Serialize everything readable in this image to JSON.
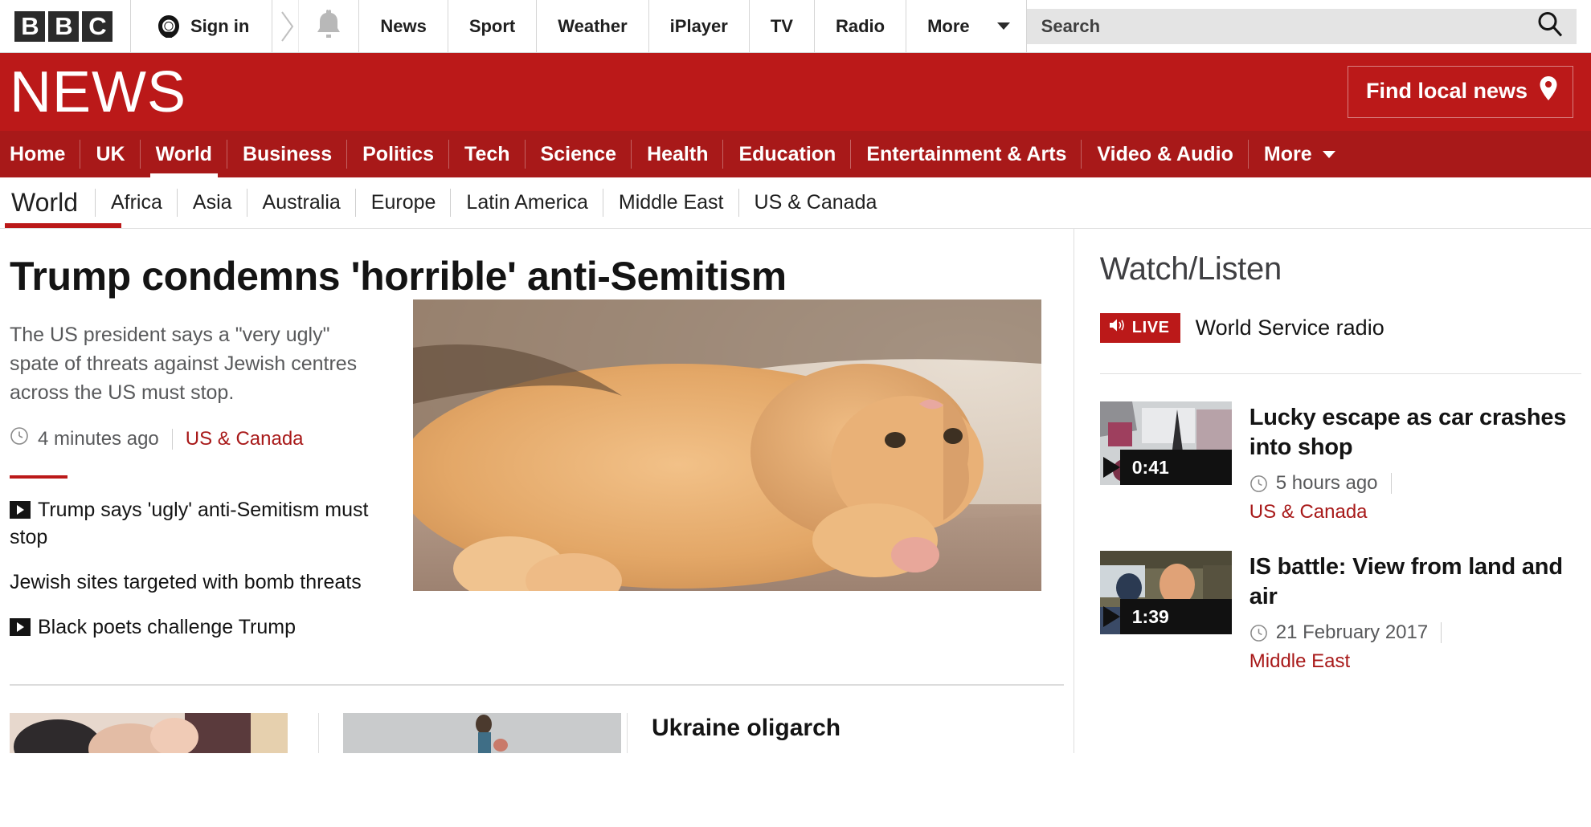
{
  "brand": {
    "logo_letters": [
      "B",
      "B",
      "C"
    ],
    "masthead_title": "NEWS",
    "accent_red": "#bb1919",
    "nav_red": "#a81919",
    "link_red": "#a81919"
  },
  "global_bar": {
    "sign_in": "Sign in",
    "account_icon": "account-icon",
    "chevron_icon": "chevron-right-icon",
    "notifications_icon": "bell-icon",
    "links": [
      "News",
      "Sport",
      "Weather",
      "iPlayer",
      "TV",
      "Radio"
    ],
    "more_label": "More",
    "search": {
      "placeholder": "Search",
      "value": "",
      "icon": "search-icon"
    }
  },
  "masthead": {
    "find_local_news": "Find local news",
    "location_icon": "location-pin-icon"
  },
  "primary_nav": {
    "items": [
      {
        "label": "Home",
        "active": false
      },
      {
        "label": "UK",
        "active": false
      },
      {
        "label": "World",
        "active": true
      },
      {
        "label": "Business",
        "active": false
      },
      {
        "label": "Politics",
        "active": false
      },
      {
        "label": "Tech",
        "active": false
      },
      {
        "label": "Science",
        "active": false
      },
      {
        "label": "Health",
        "active": false
      },
      {
        "label": "Education",
        "active": false
      },
      {
        "label": "Entertainment & Arts",
        "active": false
      },
      {
        "label": "Video & Audio",
        "active": false
      }
    ],
    "more_label": "More"
  },
  "sub_nav": {
    "items": [
      {
        "label": "World",
        "active": true
      },
      {
        "label": "Africa",
        "active": false
      },
      {
        "label": "Asia",
        "active": false
      },
      {
        "label": "Australia",
        "active": false
      },
      {
        "label": "Europe",
        "active": false
      },
      {
        "label": "Latin America",
        "active": false
      },
      {
        "label": "Middle East",
        "active": false
      },
      {
        "label": "US & Canada",
        "active": false
      }
    ]
  },
  "top_story": {
    "headline": "Trump condemns 'horrible' anti-Semitism",
    "summary": "The US president says a \"very ugly\" spate of threats against Jewish centres across the US must stop.",
    "timestamp": "4 minutes ago",
    "topic": "US & Canada",
    "clock_icon": "clock-icon",
    "image_alt": "ginger cat lying on carpet",
    "related": [
      {
        "label": "Trump says 'ugly' anti-Semitism must stop",
        "video": true
      },
      {
        "label": "Jewish sites targeted with bomb threats",
        "video": false
      },
      {
        "label": "Black poets challenge Trump",
        "video": true
      }
    ]
  },
  "story_row": {
    "items": [
      {
        "title": "",
        "has_image": true
      },
      {
        "title": "",
        "has_image": true
      },
      {
        "title": "Ukraine oligarch",
        "has_image": false
      }
    ]
  },
  "sidebar": {
    "title": "Watch/Listen",
    "live": {
      "badge": "LIVE",
      "speaker_icon": "speaker-icon",
      "label": "World Service radio"
    },
    "media": [
      {
        "title": "Lucky escape as car crashes into shop",
        "duration": "0:41",
        "timestamp": "5 hours ago",
        "topic": "US & Canada",
        "play_icon": "play-icon",
        "clock_icon": "clock-icon"
      },
      {
        "title": "IS battle: View from land and air",
        "duration": "1:39",
        "timestamp": "21 February 2017",
        "topic": "Middle East",
        "play_icon": "play-icon",
        "clock_icon": "clock-icon"
      }
    ]
  }
}
